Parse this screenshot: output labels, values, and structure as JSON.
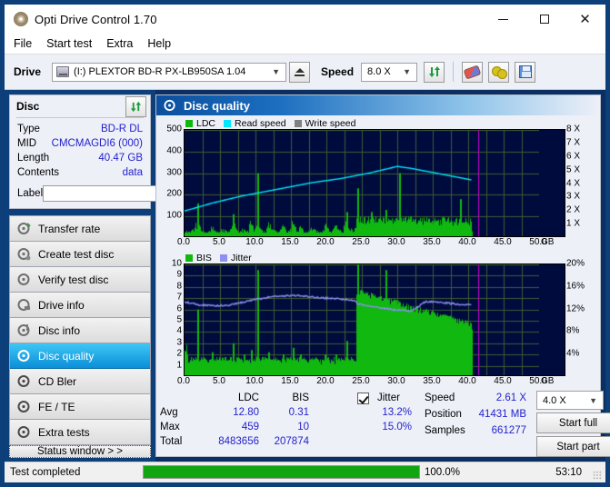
{
  "window": {
    "title": "Opti Drive Control 1.70",
    "icon": "disc-icon",
    "minimize": "minimize-icon",
    "maximize": "maximize-icon",
    "close": "close-icon"
  },
  "menu": {
    "items": [
      "File",
      "Start test",
      "Extra",
      "Help"
    ]
  },
  "toolbar": {
    "drive_label": "Drive",
    "drive_value": "(I:)  PLEXTOR BD-R  PX-LB950SA 1.04",
    "eject_label": "eject-icon",
    "speed_label": "Speed",
    "speed_value": "8.0 X",
    "refresh_label": "refresh-icon",
    "erase_label": "erase-icon",
    "plug_label": "plugin-icon",
    "save_label": "save-icon"
  },
  "disc": {
    "header": "Disc",
    "refresh": "refresh-icon",
    "rows": [
      {
        "key": "Type",
        "value": "BD-R DL"
      },
      {
        "key": "MID",
        "value": "CMCMAGDI6 (000)"
      },
      {
        "key": "Length",
        "value": "40.47 GB"
      },
      {
        "key": "Contents",
        "value": "data"
      }
    ],
    "label_key": "Label",
    "label_value": "",
    "label_placeholder": ""
  },
  "nav": {
    "items": [
      {
        "label": "Transfer rate",
        "icon": "disc-test-icon",
        "selected": false
      },
      {
        "label": "Create test disc",
        "icon": "disc-burn-icon",
        "selected": false
      },
      {
        "label": "Verify test disc",
        "icon": "disc-verify-icon",
        "selected": false
      },
      {
        "label": "Drive info",
        "icon": "drive-info-icon",
        "selected": false
      },
      {
        "label": "Disc info",
        "icon": "disc-info-icon",
        "selected": false
      },
      {
        "label": "Disc quality",
        "icon": "disc-quality-icon",
        "selected": true
      },
      {
        "label": "CD Bler",
        "icon": "cd-bler-icon",
        "selected": false
      },
      {
        "label": "FE / TE",
        "icon": "fe-te-icon",
        "selected": false
      },
      {
        "label": "Extra tests",
        "icon": "extra-tests-icon",
        "selected": false
      }
    ],
    "status_window": "Status window > >"
  },
  "panel": {
    "title": "Disc quality",
    "icon": "disc-quality-icon"
  },
  "stats": {
    "col_headers": [
      "LDC",
      "BIS"
    ],
    "row_labels": [
      "Avg",
      "Max",
      "Total"
    ],
    "ldc": {
      "avg": "12.80",
      "max": "459",
      "total": "8483656"
    },
    "bis": {
      "avg": "0.31",
      "max": "10",
      "total": "207874"
    },
    "jitter_label": "Jitter",
    "jitter_checked": true,
    "jitter_avg": "13.2%",
    "jitter_max": "15.0%",
    "speed_key": "Speed",
    "speed_value": "2.61 X",
    "position_key": "Position",
    "position_value": "41431 MB",
    "samples_key": "Samples",
    "samples_value": "661277",
    "test_speed": "4.0 X",
    "start_full": "Start full",
    "start_part": "Start part"
  },
  "statusbar": {
    "text": "Test completed",
    "progress_percent": "100.0%",
    "progress_value": 100,
    "elapsed": "53:10"
  },
  "colors": {
    "ldc_green": "#10b810",
    "read_speed_cyan": "#00e8ff",
    "write_speed_gray": "#808080",
    "bis_green": "#10b810",
    "jitter_blue": "#8d90ee",
    "plot_bg": "#000b3d",
    "grid": "#3f5c33",
    "marker_magenta": "#cc00cc",
    "accent_blue": "#0b8fd8",
    "value_text": "#2222cc"
  },
  "chart_data": [
    {
      "type": "area",
      "name": "disc-quality-ldc",
      "title": "Disc quality",
      "legend": [
        {
          "label": "LDC",
          "color": "#10b810"
        },
        {
          "label": "Read speed",
          "color": "#00e8ff"
        },
        {
          "label": "Write speed",
          "color": "#808080"
        }
      ],
      "legend_position": "top-left",
      "grid": true,
      "xlabel": "GB",
      "xlim": [
        0,
        50
      ],
      "xticks": [
        0.0,
        5.0,
        10.0,
        15.0,
        20.0,
        25.0,
        30.0,
        35.0,
        40.0,
        45.0,
        50.0
      ],
      "xticklabels": [
        "0.0",
        "5.0",
        "10.0",
        "15.0",
        "20.0",
        "25.0",
        "30.0",
        "35.0",
        "40.0",
        "45.0",
        "50.0"
      ],
      "ylabel": "LDC",
      "ylim": [
        0,
        500
      ],
      "yticks": [
        100,
        200,
        300,
        400,
        500
      ],
      "y2label": "Speed",
      "y2lim": [
        0,
        8
      ],
      "y2ticks": [
        1,
        2,
        3,
        4,
        5,
        6,
        7,
        8
      ],
      "y2ticklabels": [
        "1 X",
        "2 X",
        "3 X",
        "4 X",
        "5 X",
        "6 X",
        "7 X",
        "8 X"
      ],
      "data_end_x": 40.47,
      "marker_x": 41.43,
      "series": [
        {
          "name": "LDC",
          "color": "#10b810",
          "kind": "bars",
          "x": [
            0.3,
            0.8,
            1.3,
            1.8,
            2.3,
            2.8,
            3.3,
            3.8,
            4.3,
            4.8,
            5.3,
            5.8,
            6.3,
            6.8,
            7.3,
            7.8,
            8.3,
            8.8,
            9.3,
            9.8,
            10.3,
            10.8,
            11.3,
            11.8,
            12.3,
            12.8,
            13.3,
            13.8,
            14.3,
            14.8,
            15.3,
            15.8,
            16.3,
            16.8,
            17.3,
            17.8,
            18.3,
            18.8,
            19.3,
            19.8,
            20.3,
            20.8,
            21.3,
            21.8,
            22.3,
            22.8,
            23.3,
            23.8,
            24.3,
            24.8,
            25.3,
            25.8,
            26.3,
            26.8,
            27.3,
            27.8,
            28.3,
            28.8,
            29.3,
            29.8,
            30.3,
            30.8,
            31.3,
            31.8,
            32.3,
            32.8,
            33.3,
            33.8,
            34.3,
            34.8,
            35.3,
            35.8,
            36.3,
            36.8,
            37.3,
            37.8,
            38.3,
            38.8,
            39.3,
            39.8,
            40.3
          ],
          "values": [
            22,
            18,
            30,
            160,
            26,
            20,
            16,
            40,
            22,
            18,
            30,
            24,
            18,
            110,
            26,
            20,
            34,
            22,
            60,
            26,
            300,
            24,
            20,
            46,
            28,
            22,
            18,
            50,
            24,
            20,
            64,
            26,
            40,
            22,
            18,
            30,
            26,
            22,
            18,
            50,
            24,
            20,
            44,
            26,
            22,
            120,
            28,
            24,
            230,
            70,
            95,
            80,
            120,
            70,
            90,
            60,
            130,
            75,
            60,
            90,
            300,
            80,
            60,
            100,
            70,
            55,
            75,
            60,
            90,
            65,
            70,
            55,
            95,
            60,
            70,
            55,
            60,
            180,
            70,
            55,
            60
          ]
        },
        {
          "name": "Read speed",
          "color": "#00e8ff",
          "kind": "line",
          "x": [
            0,
            2,
            4,
            6,
            8,
            10,
            12,
            14,
            16,
            18,
            20,
            22,
            24,
            26,
            28,
            30,
            32,
            34,
            36,
            38,
            40,
            40.47
          ],
          "values": [
            2.0,
            2.3,
            2.6,
            2.85,
            3.1,
            3.3,
            3.5,
            3.7,
            3.9,
            4.1,
            4.25,
            4.4,
            4.6,
            4.8,
            5.05,
            5.3,
            5.15,
            4.95,
            4.75,
            4.55,
            4.35,
            4.3
          ]
        },
        {
          "name": "Write speed",
          "color": "#808080",
          "kind": "line",
          "x": [],
          "values": []
        }
      ]
    },
    {
      "type": "area",
      "name": "disc-quality-bis-jitter",
      "legend": [
        {
          "label": "BIS",
          "color": "#10b810"
        },
        {
          "label": "Jitter",
          "color": "#8d90ee"
        }
      ],
      "legend_position": "top-left",
      "grid": true,
      "xlabel": "GB",
      "xlim": [
        0,
        50
      ],
      "xticks": [
        0.0,
        5.0,
        10.0,
        15.0,
        20.0,
        25.0,
        30.0,
        35.0,
        40.0,
        45.0,
        50.0
      ],
      "xticklabels": [
        "0.0",
        "5.0",
        "10.0",
        "15.0",
        "20.0",
        "25.0",
        "30.0",
        "35.0",
        "40.0",
        "45.0",
        "50.0"
      ],
      "ylabel": "BIS",
      "ylim": [
        0,
        10
      ],
      "yticks": [
        1,
        2,
        3,
        4,
        5,
        6,
        7,
        8,
        9,
        10
      ],
      "y2label": "Jitter",
      "y2lim": [
        0,
        20
      ],
      "y2ticks": [
        4,
        8,
        12,
        16,
        20
      ],
      "y2ticklabels": [
        "4%",
        "8%",
        "12%",
        "16%",
        "20%"
      ],
      "data_end_x": 40.47,
      "marker_x": 41.43,
      "series": [
        {
          "name": "BIS",
          "color": "#10b810",
          "kind": "bars",
          "x": [
            0.3,
            0.8,
            1.3,
            1.8,
            2.3,
            2.8,
            3.3,
            3.8,
            4.3,
            4.8,
            5.3,
            5.8,
            6.3,
            6.8,
            7.3,
            7.8,
            8.3,
            8.8,
            9.3,
            9.8,
            10.3,
            10.8,
            11.3,
            11.8,
            12.3,
            12.8,
            13.3,
            13.8,
            14.3,
            14.8,
            15.3,
            15.8,
            16.3,
            16.8,
            17.3,
            17.8,
            18.3,
            18.8,
            19.3,
            19.8,
            20.3,
            20.8,
            21.3,
            21.8,
            22.3,
            22.8,
            23.3,
            23.8,
            24.3,
            24.8,
            25.3,
            25.8,
            26.3,
            26.8,
            27.3,
            27.8,
            28.3,
            28.8,
            29.3,
            29.8,
            30.3,
            30.8,
            31.3,
            31.8,
            32.3,
            32.8,
            33.3,
            33.8,
            34.3,
            34.8,
            35.3,
            35.8,
            36.3,
            36.8,
            37.3,
            37.8,
            38.3,
            38.8,
            39.3,
            39.8,
            40.3
          ],
          "values": [
            2.0,
            1.5,
            1.2,
            6.0,
            1.4,
            1.2,
            1.0,
            2.2,
            1.4,
            1.2,
            1.6,
            1.4,
            1.2,
            3.0,
            1.4,
            1.2,
            2.0,
            1.4,
            2.4,
            1.4,
            9.5,
            1.4,
            1.2,
            2.2,
            1.4,
            1.2,
            1.0,
            2.0,
            1.4,
            1.2,
            2.6,
            1.4,
            2.0,
            1.2,
            1.0,
            1.6,
            1.4,
            1.2,
            1.0,
            2.0,
            1.4,
            1.2,
            2.0,
            1.4,
            1.2,
            3.2,
            1.4,
            1.2,
            10.0,
            7.0,
            6.5,
            6.2,
            5.8,
            5.6,
            5.4,
            5.2,
            9.5,
            5.0,
            4.8,
            4.6,
            4.5,
            4.3,
            4.2,
            4.0,
            3.9,
            3.8,
            3.7,
            3.6,
            3.5,
            3.5,
            3.4,
            3.3,
            3.3,
            3.2,
            3.2,
            3.1,
            3.1,
            3.0,
            3.0,
            3.0,
            3.0
          ]
        },
        {
          "name": "Jitter",
          "color": "#8d90ee",
          "kind": "line",
          "x": [
            0,
            2,
            4,
            6,
            8,
            10,
            12,
            14,
            16,
            18,
            20,
            22,
            24,
            24.5,
            26,
            28,
            30,
            32,
            34,
            36,
            38,
            40,
            40.47
          ],
          "values": [
            13.4,
            12.8,
            12.7,
            12.7,
            13.2,
            13.8,
            14.2,
            14.4,
            14.5,
            14.2,
            14.0,
            13.9,
            13.6,
            13.0,
            12.6,
            12.2,
            11.9,
            11.7,
            13.4,
            13.3,
            13.0,
            12.8,
            12.8
          ]
        }
      ]
    }
  ]
}
